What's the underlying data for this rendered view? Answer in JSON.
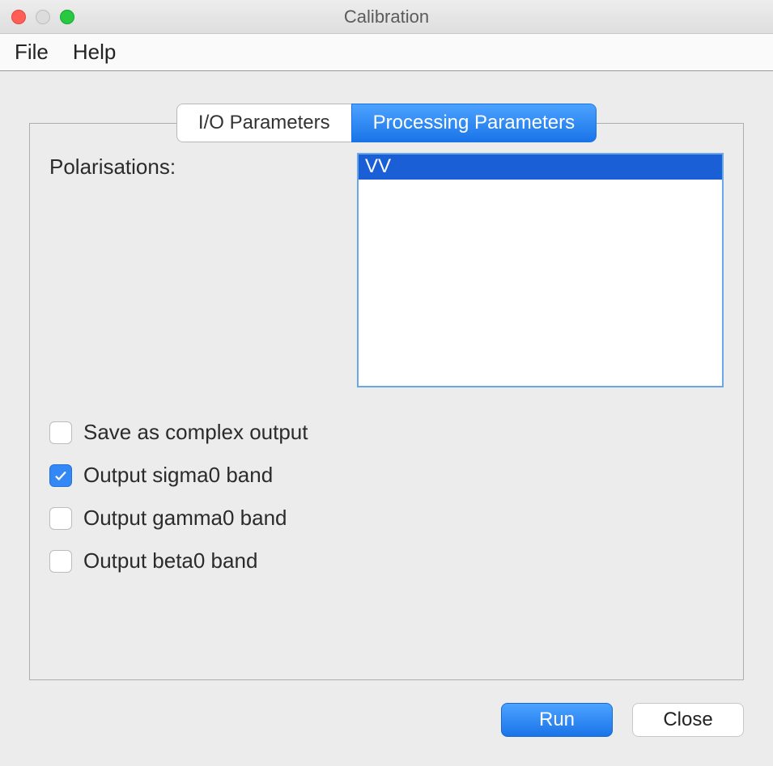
{
  "window": {
    "title": "Calibration"
  },
  "menu": {
    "file": "File",
    "help": "Help"
  },
  "tabs": {
    "io": "I/O Parameters",
    "processing": "Processing Parameters"
  },
  "panel": {
    "polarisations_label": "Polarisations:",
    "polarisations_items": {
      "0": "VV"
    },
    "checkboxes": {
      "save_complex": {
        "label": "Save as complex output",
        "checked": false
      },
      "sigma0": {
        "label": "Output sigma0 band",
        "checked": true
      },
      "gamma0": {
        "label": "Output gamma0 band",
        "checked": false
      },
      "beta0": {
        "label": "Output beta0 band",
        "checked": false
      }
    }
  },
  "buttons": {
    "run": "Run",
    "close": "Close"
  }
}
